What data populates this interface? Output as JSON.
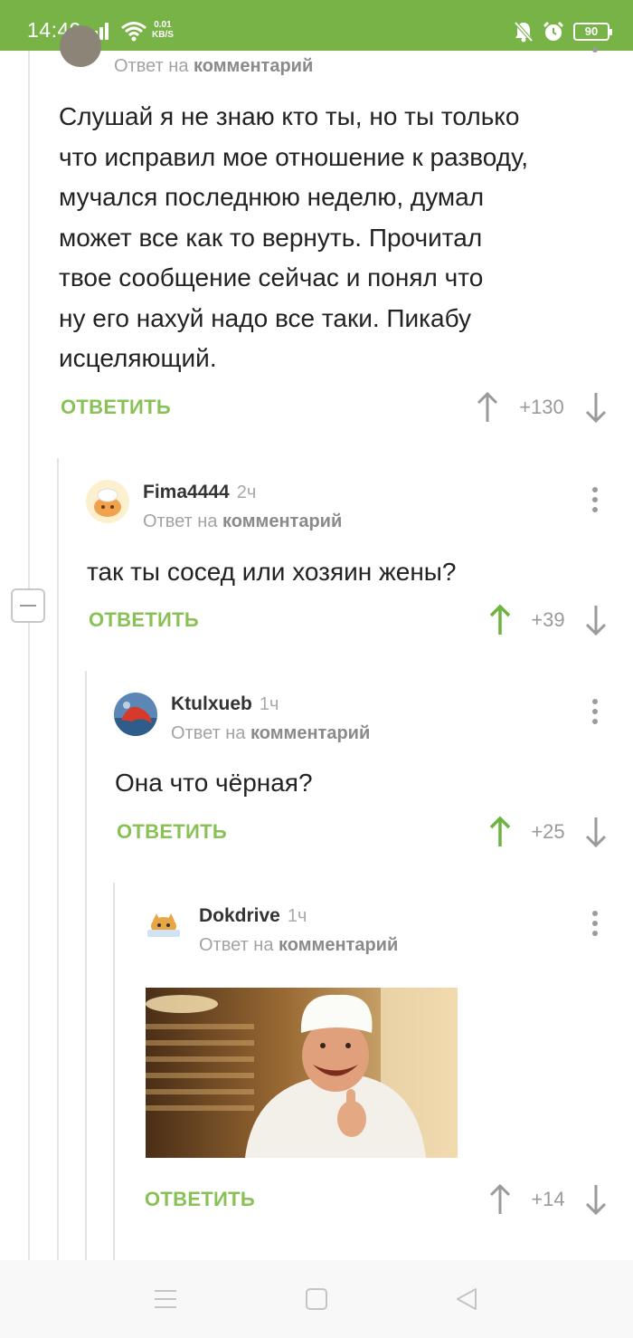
{
  "status_bar": {
    "time": "14:49",
    "speed_top": "0.01",
    "speed_bottom": "KB/S",
    "battery": "90"
  },
  "colors": {
    "accent": "#77b347",
    "reply": "#8ac157",
    "upvoted": "#6db33f"
  },
  "comments": [
    {
      "reply_to_prefix": "Ответ на",
      "reply_to_target": "комментарий",
      "text_lines": [
        "Слушай я не знаю кто ты, но ты только",
        "что исправил мое отношение к разводу,",
        "мучался последнюю неделю, думал",
        "может все как то вернуть. Прочитал",
        "твое сообщение сейчас и понял что",
        "ну его нахуй надо все таки. Пикабу",
        "исцеляющий."
      ],
      "reply_label": "ОТВЕТИТЬ",
      "rating": "+130",
      "upvoted": false
    },
    {
      "author": "Fima4444",
      "time": "2ч",
      "reply_to_prefix": "Ответ на",
      "reply_to_target": "комментарий",
      "text": "так ты сосед или хозяин жены?",
      "reply_label": "ОТВЕТИТЬ",
      "rating": "+39",
      "upvoted": true
    },
    {
      "author": "Ktulxueb",
      "time": "1ч",
      "reply_to_prefix": "Ответ на",
      "reply_to_target": "комментарий",
      "text": "Она что чёрная?",
      "reply_label": "ОТВЕТИТЬ",
      "rating": "+25",
      "upvoted": true
    },
    {
      "author": "Dokdrive",
      "time": "1ч",
      "reply_to_prefix": "Ответ на",
      "reply_to_target": "комментарий",
      "image": "laughing-chef-thumbs-up-gif",
      "reply_label": "ОТВЕТИТЬ",
      "rating": "+14",
      "upvoted": false
    }
  ],
  "nav": {
    "menu_icon": "recent-apps-icon",
    "home_icon": "home-icon",
    "back_icon": "back-icon"
  }
}
